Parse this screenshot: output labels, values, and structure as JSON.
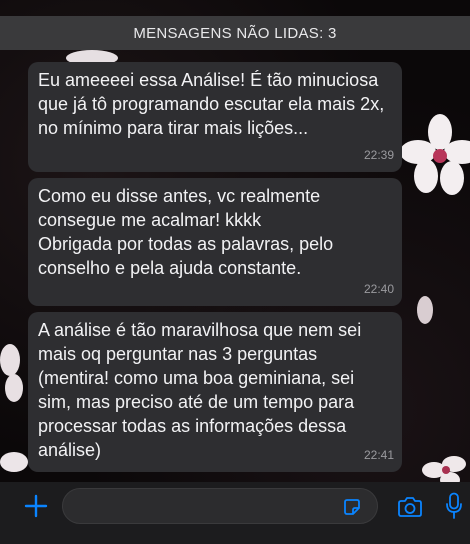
{
  "unread_banner": "MENSAGENS NÃO LIDAS: 3",
  "messages": [
    {
      "text": "Eu ameeeei essa Análise! É tão minuciosa que já tô programando escutar ela mais 2x, no mínimo para tirar mais lições...",
      "time": "22:39"
    },
    {
      "text": "Como eu disse antes, vc realmente consegue me acalmar! kkkk\nObrigada por todas as palavras, pelo conselho e pela ajuda constante.",
      "time": "22:40"
    },
    {
      "text": "A análise é tão maravilhosa que nem sei mais oq perguntar nas 3 perguntas (mentira! como uma boa geminiana, sei sim, mas preciso até de um tempo para processar todas as informações dessa análise)",
      "time": "22:41"
    }
  ],
  "composer": {
    "input_value": "",
    "icons": [
      "plus-icon",
      "sticker-icon",
      "camera-icon",
      "microphone-icon"
    ],
    "accent_color": "#0a84ff"
  }
}
